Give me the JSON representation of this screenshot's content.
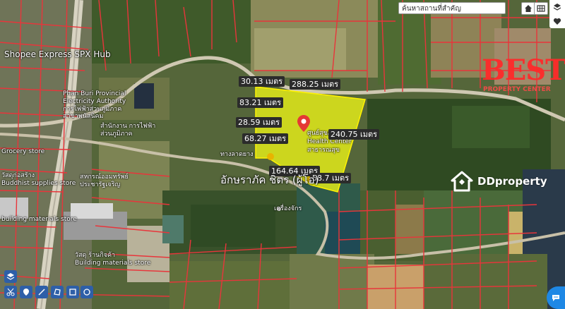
{
  "search": {
    "placeholder": "ค้นหาสถานที่สำคัญ"
  },
  "top_right_icons": [
    "home-icon",
    "grid-icon",
    "layers-icon",
    "heart-icon"
  ],
  "place_labels": {
    "shopee": "Shopee Express SPX Hub",
    "pea_line1": "Phan Buri Provincial",
    "pea_line2": "Electricity Authority",
    "pea_thai_line1": "การไฟฟ้าส่วนภูมิภาค",
    "pea_thai_line2": "สาขาพนัสนิคม",
    "pea_thai2_line1": "สำนักงาน การไฟฟ้า",
    "pea_thai2_line2": "ส่วนภูมิภาค",
    "grocery": "Grocery store",
    "supply_thai": "วัสดุก่อสร้าง",
    "supply": "Buddhist supplies store",
    "cooperative_line1": "สหกรณ์ออมทรัพย์",
    "cooperative_line2": "ประชารัฐเจริญ",
    "materials": "building materials store",
    "hardware_thai": "วัสดุ ร้านกิจค้า",
    "hardware": "Building materials store",
    "station_thai": "ศูนย์สุขภาพชุมชน",
    "health_center": "Health Center",
    "health_thai": "สาธารณสุข",
    "machine": "เครื่องจักร",
    "road_label": "ทางลาดยาง"
  },
  "measurements": [
    "30.13 เมตร",
    "288.25 เมตร",
    "83.21 เมตร",
    "28.59 เมตร",
    "68.27 เมตร",
    "240.75 เมตร",
    "164.64 เมตร",
    "58.7 เมตร"
  ],
  "owner_label": "อักษราภัค ชิตร (ผู้โอ)",
  "watermark": {
    "brand": "BEST",
    "sub": "PROPERTY CENTER"
  },
  "ddproperty": "DDproperty",
  "colors": {
    "parcel_fill": "#e6ef18",
    "parcel_lines": "#e8353b",
    "pin": "#e53935",
    "tool_bg": "#2e5fa8",
    "chat": "#1e88e5"
  },
  "tool_icons": [
    "layer-tool-icon",
    "scissors-icon",
    "pin-tool-icon",
    "line-tool-icon",
    "polygon-tool-icon",
    "square-tool-icon",
    "circle-tool-icon",
    "ruler-tool-icon"
  ]
}
